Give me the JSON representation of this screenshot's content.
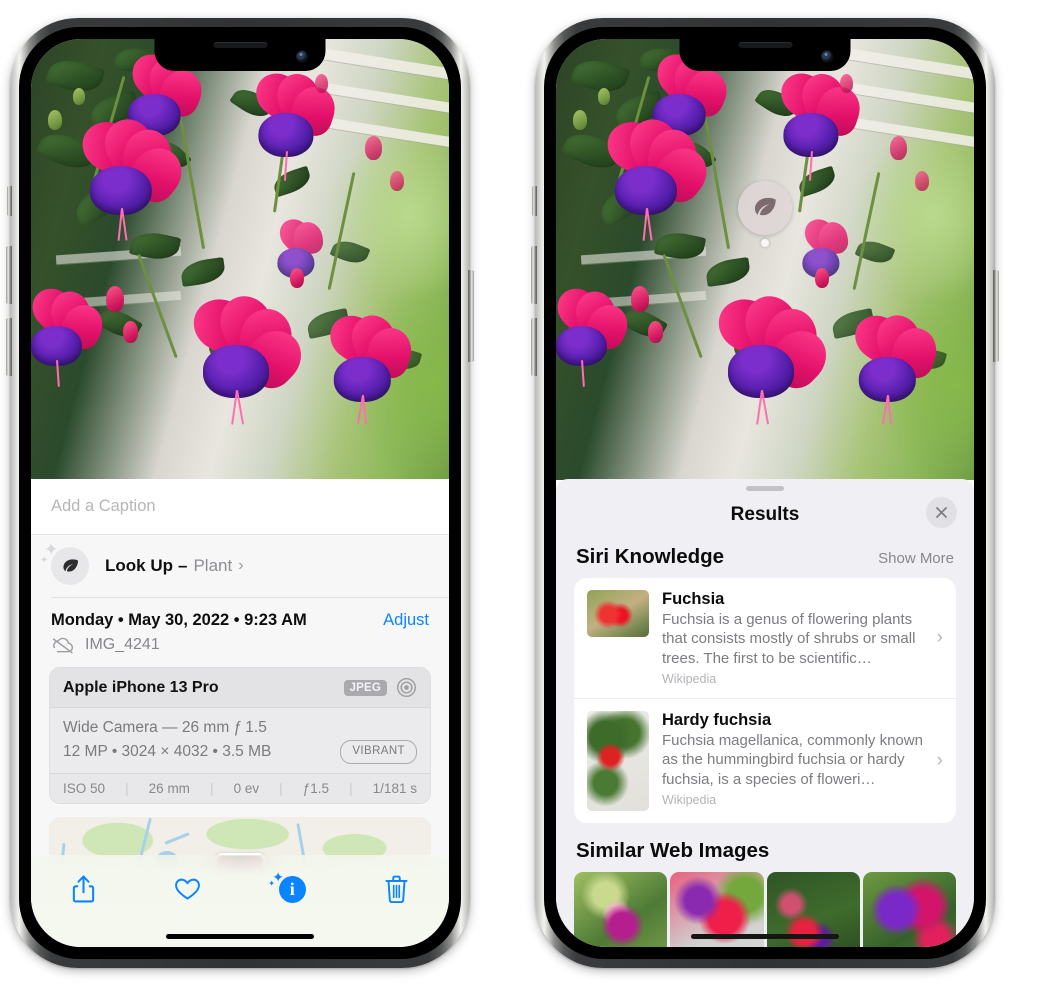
{
  "left_phone": {
    "photo": {
      "alt": "fuchsia-flowers-photo"
    },
    "caption_field": {
      "placeholder": "Add a Caption",
      "value": ""
    },
    "look_up": {
      "icon": "leaf-icon",
      "title": "Look Up",
      "dash": "–",
      "subject": "Plant",
      "chevron": "›"
    },
    "meta": {
      "date": "Monday • May 30, 2022 • 9:23 AM",
      "adjust_label": "Adjust",
      "filename": "IMG_4241",
      "cloud_icon": "icloud-slash-icon"
    },
    "exif": {
      "model": "Apple iPhone 13 Pro",
      "format_badge": "JPEG",
      "hdr_icon": "aperture-icon",
      "lens_line": "Wide Camera — 26 mm ƒ 1.5",
      "size_line": "12 MP • 3024 × 4032 • 3.5 MB",
      "style_pill": "VIBRANT",
      "stats": [
        "ISO 50",
        "26 mm",
        "0 ev",
        "ƒ1.5",
        "1/181 s"
      ],
      "separator": "|"
    },
    "map": {
      "alt": "location-map-preview"
    },
    "toolbar": [
      {
        "name": "share-button",
        "icon": "share-icon"
      },
      {
        "name": "favorite-button",
        "icon": "heart-icon"
      },
      {
        "name": "info-button",
        "icon": "info-sparkle-icon",
        "glyph": "i"
      },
      {
        "name": "delete-button",
        "icon": "trash-icon"
      }
    ]
  },
  "right_phone": {
    "photo": {
      "alt": "fuchsia-flowers-photo"
    },
    "badge": {
      "icon": "leaf-icon"
    },
    "sheet": {
      "title": "Results",
      "close_label": "✕"
    },
    "siri_knowledge": {
      "title": "Siri Knowledge",
      "action": "Show More",
      "items": [
        {
          "title": "Fuchsia",
          "description": "Fuchsia is a genus of flowering plants that consists mostly of shrubs or small trees. The first to be scientific…",
          "source": "Wikipedia",
          "chevron": "›",
          "thumb": "fuchsia-red-flowers-thumb"
        },
        {
          "title": "Hardy fuchsia",
          "description": "Fuchsia magellanica, commonly known as the hummingbird fuchsia or hardy fuchsia, is a species of floweri…",
          "source": "Wikipedia",
          "chevron": "›",
          "thumb": "hardy-fuchsia-specimen-thumb"
        }
      ]
    },
    "similar_web_images": {
      "title": "Similar Web Images",
      "items": [
        {
          "alt": "fuchsia-web-image-1"
        },
        {
          "alt": "fuchsia-web-image-2"
        },
        {
          "alt": "fuchsia-web-image-3"
        },
        {
          "alt": "fuchsia-web-image-4"
        }
      ]
    }
  },
  "colors": {
    "accent_blue": "#0a84ff",
    "sheet_bg": "#f0f0f4",
    "info_bg": "#f7f7f7",
    "card_bg": "#ffffff",
    "secondary_text": "#8e8e93"
  }
}
